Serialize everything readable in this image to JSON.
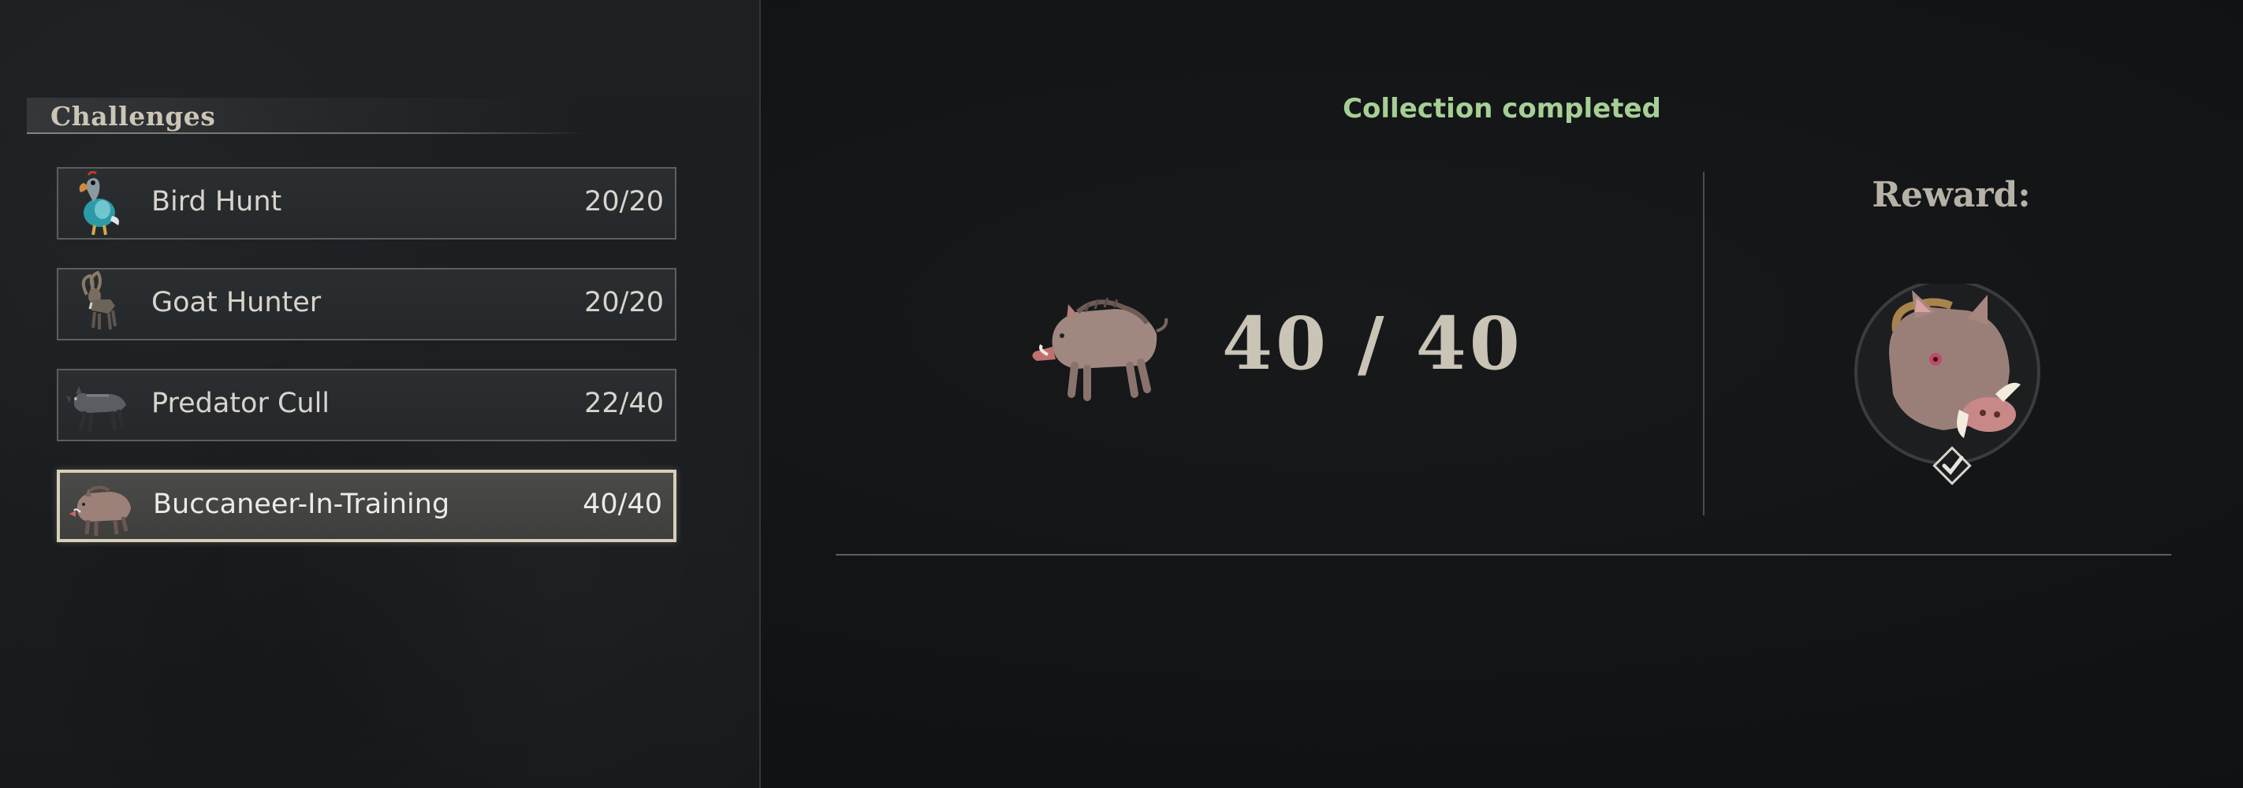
{
  "sidebar": {
    "title": "Challenges",
    "items": [
      {
        "label": "Bird Hunt",
        "count": "20/20",
        "icon": "dodo-bird-icon",
        "selected": false
      },
      {
        "label": "Goat Hunter",
        "count": "20/20",
        "icon": "goat-icon",
        "selected": false
      },
      {
        "label": "Predator Cull",
        "count": "22/40",
        "icon": "hyena-icon",
        "selected": false
      },
      {
        "label": "Buccaneer-In-Training",
        "count": "40/40",
        "icon": "boar-icon",
        "selected": true
      }
    ]
  },
  "main": {
    "status": "Collection completed",
    "progress": {
      "count": "40 / 40",
      "current": 40,
      "total": 40,
      "icon": "boar-icon"
    },
    "reward": {
      "label": "Reward:",
      "icon": "boar-head-trophy-icon",
      "claimed": true,
      "claimed_icon": "check-diamond-icon"
    }
  },
  "colors": {
    "status_green": "#a7cf95",
    "selected_border": "#d8cfb9",
    "text_light": "#d8d4cc",
    "background": "#121416"
  }
}
